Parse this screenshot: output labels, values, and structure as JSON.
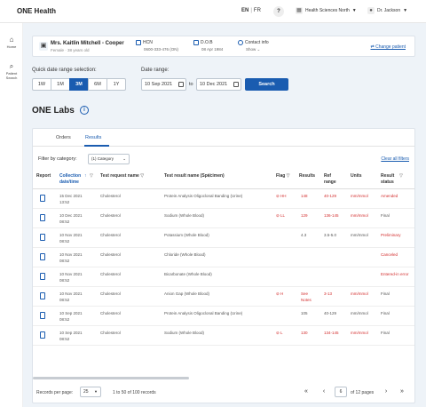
{
  "header": {
    "app_title": "ONE Health",
    "lang_en": "EN",
    "lang_fr": "FR",
    "help_label": "?",
    "org_name": "Health Sciences North",
    "user_name": "Dr. Jackson"
  },
  "sidebar": {
    "items": [
      {
        "label": "Home",
        "icon": "home-icon"
      },
      {
        "label": "Patient Search",
        "icon": "search-icon"
      }
    ]
  },
  "patient": {
    "name": "Mrs. Kaitlin Mitchell - Cooper",
    "subtitle": "Female · 38 years old",
    "hcn_label": "HCN",
    "hcn_value": "0600-333-476 (ON)",
    "dob_label": "D.O.B",
    "dob_value": "08 Apr 1984",
    "contact_label": "Contact info",
    "contact_value": "Show",
    "change_patient": "Change patient"
  },
  "filters": {
    "quick_label": "Quick date range selection:",
    "quick_options": [
      "1W",
      "1M",
      "3M",
      "6M",
      "1Y"
    ],
    "quick_selected": "3M",
    "range_label": "Date range:",
    "date_from": "10 Sep 2021",
    "date_to": "10 Dec 2021",
    "to_label": "to",
    "search_label": "Search"
  },
  "page_title": "ONE Labs",
  "tabs": {
    "orders": "Orders",
    "results": "Results",
    "active": "Results"
  },
  "category_filter": {
    "label": "Filter by category:",
    "value": "(1) Category",
    "clear_all": "Clear all filters"
  },
  "table": {
    "headers": {
      "report": "Report",
      "collection": "Collection date/time",
      "test_request": "Test request name",
      "test_result": "Test result name (Specimen)",
      "flag": "Flag",
      "results": "Results",
      "ref_range": "Ref range",
      "units": "Units",
      "result_status": "Result status"
    },
    "rows": [
      {
        "date": "15 Dec 2021",
        "time": "13:52",
        "request": "Cholesterol",
        "result_name": "Protein Analysis Oligoclonal Banding (Urine)",
        "flag": "HH",
        "value": "148",
        "ref": "40-129",
        "units": "mm/mmol",
        "status": "Amended",
        "flag_red": true,
        "value_red": true,
        "ref_red": true,
        "units_red": true,
        "status_red": true
      },
      {
        "date": "10 Dec 2021",
        "time": "08:52",
        "request": "Cholesterol",
        "result_name": "Sodium (Whole Blood)",
        "flag": "LL",
        "value": "129",
        "ref": "136-145",
        "units": "mm/mmol",
        "status": "Final",
        "flag_red": true,
        "value_red": true,
        "ref_red": true,
        "units_red": true,
        "status_red": false
      },
      {
        "date": "10 Nov 2021",
        "time": "08:52",
        "request": "Cholesterol",
        "result_name": "Potassium (Whole Blood)",
        "flag": "",
        "value": "4.3",
        "ref": "3.5-5.0",
        "units": "mm/mmol",
        "status": "Preliminary",
        "flag_red": false,
        "value_red": false,
        "ref_red": false,
        "units_red": false,
        "status_red": true
      },
      {
        "date": "10 Nov 2021",
        "time": "08:52",
        "request": "Cholesterol",
        "result_name": "Chloride (Whole Blood)",
        "flag": "",
        "value": "",
        "ref": "",
        "units": "",
        "status": "Canceled",
        "flag_red": false,
        "value_red": false,
        "ref_red": false,
        "units_red": false,
        "status_red": true
      },
      {
        "date": "10 Nov 2021",
        "time": "08:52",
        "request": "Cholesterol",
        "result_name": "Bicarbonate (Whole Blood)",
        "flag": "",
        "value": "",
        "ref": "",
        "units": "",
        "status": "Entered-in error",
        "flag_red": false,
        "value_red": false,
        "ref_red": false,
        "units_red": false,
        "status_red": true
      },
      {
        "date": "10 Nov 2021",
        "time": "08:52",
        "request": "Cholesterol",
        "result_name": "Anion Gap (Whole Blood)",
        "flag": "H",
        "value": "See Notes",
        "ref": "3-13",
        "units": "mm/mmol",
        "status": "Final",
        "flag_red": true,
        "value_red": true,
        "ref_red": true,
        "units_red": true,
        "status_red": false
      },
      {
        "date": "10 Sep 2021",
        "time": "08:52",
        "request": "Cholesterol",
        "result_name": "Protein Analysis Oligoclonal Banding (Urine)",
        "flag": "",
        "value": "105",
        "ref": "40-129",
        "units": "mm/mmol",
        "status": "Final",
        "flag_red": false,
        "value_red": false,
        "ref_red": false,
        "units_red": false,
        "status_red": false
      },
      {
        "date": "10 Sep 2021",
        "time": "08:52",
        "request": "Cholesterol",
        "result_name": "Sodium (Whole Blood)",
        "flag": "L",
        "value": "130",
        "ref": "134-145",
        "units": "mm/mmol",
        "status": "Final",
        "flag_red": true,
        "value_red": true,
        "ref_red": true,
        "units_red": true,
        "status_red": false
      }
    ]
  },
  "pagination": {
    "rows_label": "Records per page:",
    "rows_value": "25",
    "range_text": "1 to 50 of 100 records",
    "current_page": "6",
    "total_text": "of 12 pages"
  }
}
